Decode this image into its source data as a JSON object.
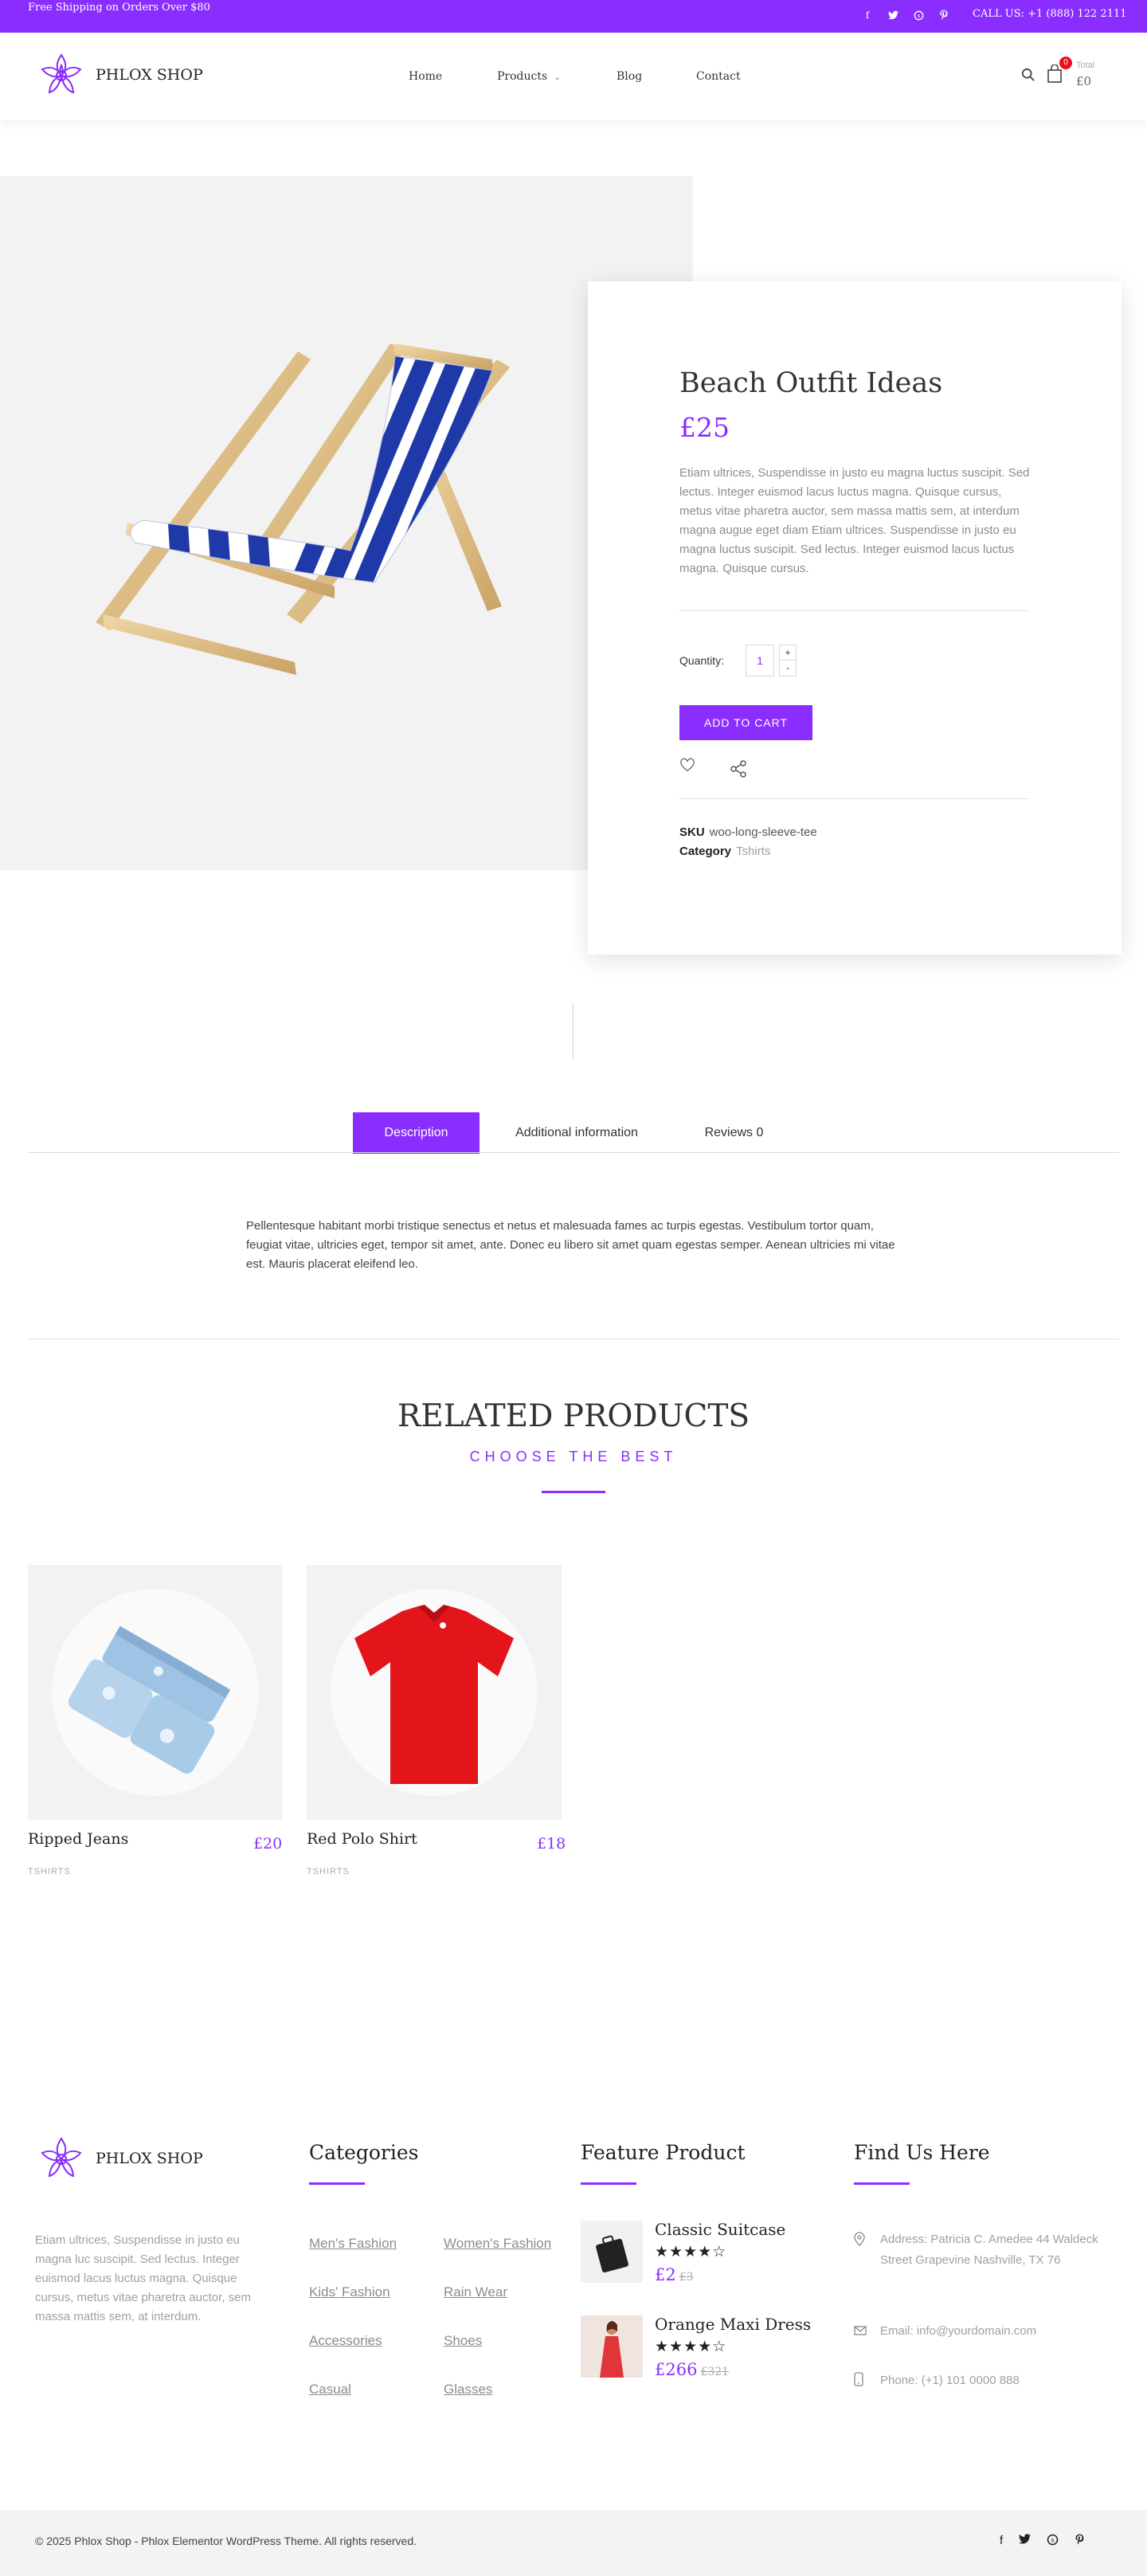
{
  "topbar": {
    "shipping": "Free Shipping on Orders Over $80",
    "socials": [
      "facebook-icon",
      "twitter-icon",
      "skype-icon",
      "pinterest-icon"
    ],
    "call": "CALL US: +1 (888) 122 2111"
  },
  "header": {
    "brand": "PHLOX SHOP",
    "nav": [
      "Home",
      "Products",
      "Blog",
      "Contact"
    ],
    "cart_count": "0",
    "cart_total_label": "Total",
    "cart_total": "£0"
  },
  "product": {
    "title": "Beach Outfit Ideas",
    "price": "£25",
    "description": "Etiam ultrices, Suspendisse in justo eu magna luctus suscipit. Sed lectus. Integer euismod lacus luctus magna. Quisque cursus, metus vitae pharetra auctor, sem massa mattis sem, at interdum magna augue eget diam Etiam ultrices. Suspendisse in justo eu magna luctus suscipit. Sed lectus. Integer euismod lacus luctus magna. Quisque cursus.",
    "quantity_label": "Quantity:",
    "quantity": "1",
    "plus": "+",
    "minus": "-",
    "add_to_cart": "ADD TO CART",
    "sku_label": "SKU",
    "sku": "woo-long-sleeve-tee",
    "category_label": "Category",
    "category": "Tshirts"
  },
  "tabs": {
    "items": [
      "Description",
      "Additional information",
      "Reviews 0"
    ],
    "active": 0,
    "content": "Pellentesque habitant morbi tristique senectus et netus et malesuada fames ac turpis egestas. Vestibulum tortor quam, feugiat vitae, ultricies eget, tempor sit amet, ante. Donec eu libero sit amet quam egestas semper. Aenean ultricies mi vitae est. Mauris placerat eleifend leo."
  },
  "related": {
    "title": "RELATED PRODUCTS",
    "subtitle": "CHOOSE THE BEST",
    "items": [
      {
        "name": "Ripped Jeans",
        "price": "£20",
        "category": "TSHIRTS"
      },
      {
        "name": "Red Polo Shirt",
        "price": "£18",
        "category": "TSHIRTS"
      }
    ]
  },
  "footer": {
    "brand": "PHLOX SHOP",
    "about": "Etiam ultrices, Suspendisse in justo eu magna luc suscipit. Sed lectus. Integer euismod lacus luctus magna. Quisque cursus, metus vitae pharetra auctor, sem massa mattis sem, at interdum.",
    "categories_title": "Categories",
    "categories": [
      "Men's Fashion",
      "Women's Fashion",
      "Kids' Fashion",
      "Rain Wear",
      "Accessories",
      "Shoes",
      "Casual",
      "Glasses"
    ],
    "feature_title": "Feature Product",
    "features": [
      {
        "name": "Classic Suitcase",
        "stars": "★★★★☆",
        "price": "£2",
        "old_price": "£3"
      },
      {
        "name": "Orange Maxi Dress",
        "stars": "★★★★☆",
        "price": "£266",
        "old_price": "£321"
      }
    ],
    "find_title": "Find Us Here",
    "address": "Address: Patricia C. Amedee 44 Waldeck Street Grapevine Nashville, TX 76",
    "email": "Email: info@yourdomain.com",
    "phone": "Phone: (+1) 101 0000 888",
    "copyright": "© 2025 Phlox Shop - Phlox Elementor WordPress Theme. All rights reserved.",
    "socials": [
      "facebook-icon",
      "twitter-icon",
      "skype-icon",
      "pinterest-icon"
    ]
  },
  "colors": {
    "accent": "#8a2eff",
    "badge": "#e8101b"
  }
}
